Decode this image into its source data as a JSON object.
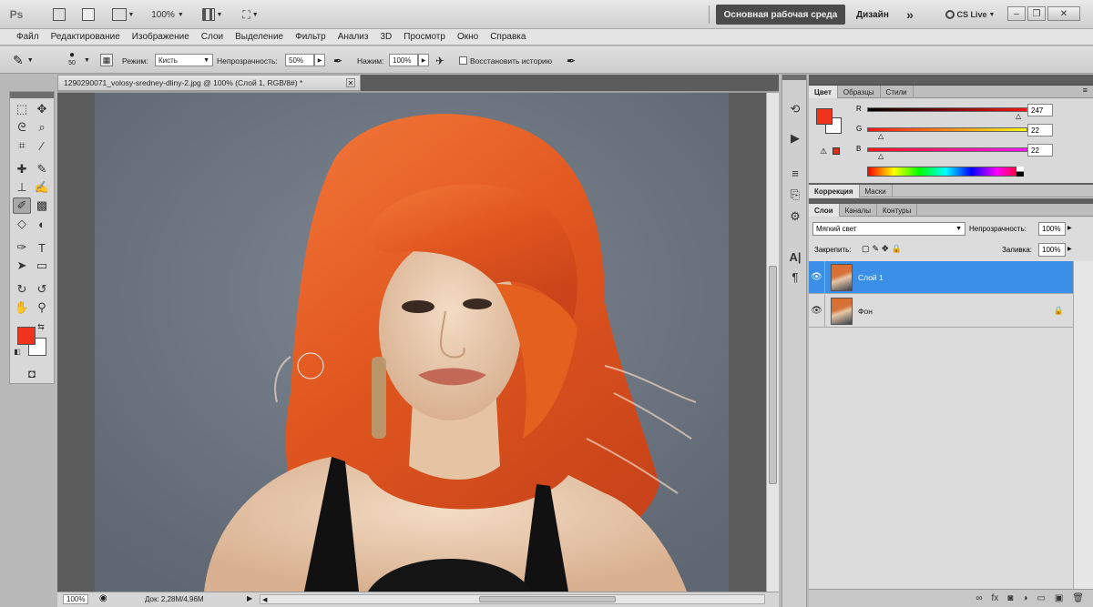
{
  "app": {
    "logo": "Ps",
    "zoom": "100%",
    "workspace_active": "Основная рабочая среда",
    "workspace_design": "Дизайн",
    "more": "»",
    "cs_live": "CS Live"
  },
  "menu": [
    "Файл",
    "Редактирование",
    "Изображение",
    "Слои",
    "Выделение",
    "Фильтр",
    "Анализ",
    "3D",
    "Просмотр",
    "Окно",
    "Справка"
  ],
  "options": {
    "brush_size": "50",
    "mode_label": "Режим:",
    "mode_value": "Кисть",
    "opacity_label": "Непрозрачность:",
    "opacity_value": "50%",
    "pressure_label": "Нажим:",
    "pressure_value": "100%",
    "history_label": "Восстановить историю"
  },
  "document": {
    "tab_title": "1290290071_volosy-sredney-dliny-2.jpg @ 100% (Слой 1, RGB/8#) *",
    "zoom": "100%",
    "doc_size": "Док: 2,28M/4,96M"
  },
  "colors": {
    "foreground": "#f0331d",
    "background": "#ffffff",
    "accent_select": "#3c8fe6"
  },
  "color_panel": {
    "tabs": [
      "Цвет",
      "Образцы",
      "Стили"
    ],
    "r_label": "R",
    "r_value": "247",
    "g_label": "G",
    "g_value": "22",
    "b_label": "B",
    "b_value": "22"
  },
  "adjust_panel": {
    "tabs": [
      "Коррекция",
      "Маски"
    ]
  },
  "layers_panel": {
    "tabs": [
      "Слои",
      "Каналы",
      "Контуры"
    ],
    "blend_mode": "Мягкий свет",
    "opacity_label": "Непрозрачность:",
    "opacity_value": "100%",
    "lock_label": "Закрепить:",
    "fill_label": "Заливка:",
    "fill_value": "100%",
    "layers": [
      {
        "name": "Слой 1",
        "selected": true
      },
      {
        "name": "Фон",
        "selected": false
      }
    ]
  }
}
